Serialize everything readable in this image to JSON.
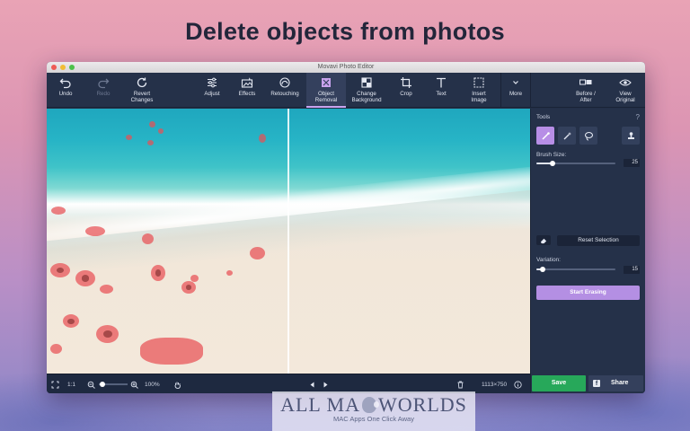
{
  "headline": "Delete objects from photos",
  "window": {
    "title": "Movavi Photo Editor"
  },
  "toolbar": {
    "undo": "Undo",
    "redo": "Redo",
    "revert": "Revert\nChanges",
    "adjust": "Adjust",
    "effects": "Effects",
    "retouching": "Retouching",
    "object_removal": "Object\nRemoval",
    "change_background": "Change\nBackground",
    "crop": "Crop",
    "text": "Text",
    "insert_image": "Insert\nImage",
    "more": "More",
    "before_after": "Before /\nAfter",
    "view_original": "View\nOriginal"
  },
  "panel": {
    "tools_label": "Tools",
    "help": "?",
    "brush_size_label": "Brush Size:",
    "brush_size_value": "25",
    "brush_size_fraction": 0.2,
    "reset_selection": "Reset Selection",
    "variation_label": "Variation:",
    "variation_value": "15",
    "variation_fraction": 0.08,
    "start_erasing": "Start Erasing"
  },
  "status": {
    "ratio": "1:1",
    "zoom": "100%",
    "dimensions": "1113×750"
  },
  "actions": {
    "save": "Save",
    "share": "Share"
  },
  "watermark": {
    "left": "ALL MA",
    "right": "WORLDS",
    "tagline": "MAC Apps One Click Away"
  },
  "colors": {
    "accent": "#b48fe3",
    "save": "#27a85a",
    "selection": "#e85055"
  }
}
